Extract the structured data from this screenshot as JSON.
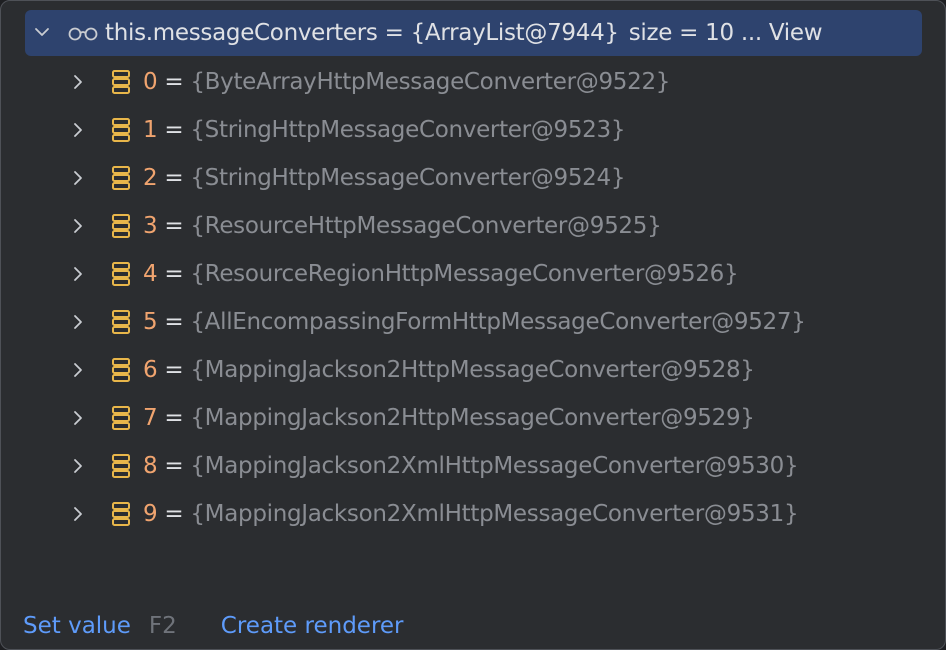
{
  "root": {
    "expand_icon": "chevron-down-icon",
    "watch_icon": "glasses-icon",
    "name": "this.messageConverters",
    "equals": " = ",
    "value": "{ArrayList@7944}",
    "size": "size = 10",
    "ellipsis": " ... ",
    "view": "View"
  },
  "children": [
    {
      "index": "0",
      "equals": " = ",
      "value": "{ByteArrayHttpMessageConverter@9522}"
    },
    {
      "index": "1",
      "equals": " = ",
      "value": "{StringHttpMessageConverter@9523}"
    },
    {
      "index": "2",
      "equals": " = ",
      "value": "{StringHttpMessageConverter@9524}"
    },
    {
      "index": "3",
      "equals": " = ",
      "value": "{ResourceHttpMessageConverter@9525}"
    },
    {
      "index": "4",
      "equals": " = ",
      "value": "{ResourceRegionHttpMessageConverter@9526}"
    },
    {
      "index": "5",
      "equals": " = ",
      "value": "{AllEncompassingFormHttpMessageConverter@9527}"
    },
    {
      "index": "6",
      "equals": " = ",
      "value": "{MappingJackson2HttpMessageConverter@9528}"
    },
    {
      "index": "7",
      "equals": " = ",
      "value": "{MappingJackson2HttpMessageConverter@9529}"
    },
    {
      "index": "8",
      "equals": " = ",
      "value": "{MappingJackson2XmlHttpMessageConverter@9530}"
    },
    {
      "index": "9",
      "equals": " = ",
      "value": "{MappingJackson2XmlHttpMessageConverter@9531}"
    }
  ],
  "footer": {
    "set_value": "Set value",
    "set_value_shortcut": "F2",
    "create_renderer": "Create renderer"
  },
  "colors": {
    "background": "#2b2d30",
    "selection": "#2e436e",
    "index": "#f0a46f",
    "value_text": "#8a8d93",
    "link": "#5e9bfa",
    "field_icon": "#e8b64a"
  }
}
